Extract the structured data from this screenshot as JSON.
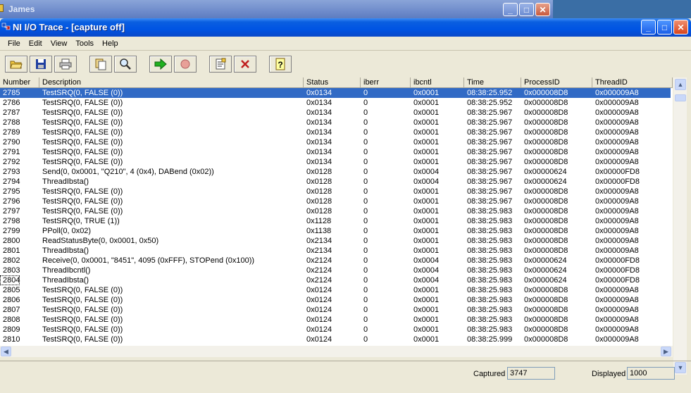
{
  "background_window": {
    "title": "James"
  },
  "window": {
    "title": "NI I/O Trace - [capture off]"
  },
  "menu": [
    "File",
    "Edit",
    "View",
    "Tools",
    "Help"
  ],
  "toolbar": [
    "open-icon",
    "save-icon",
    "print-icon",
    "copy-icon",
    "find-icon",
    "start-capture-icon",
    "stop-capture-icon",
    "properties-icon",
    "delete-icon",
    "help-icon"
  ],
  "columns": [
    "Number",
    "Description",
    "Status",
    "iberr",
    "ibcntl",
    "Time",
    "ProcessID",
    "ThreadID"
  ],
  "rows": [
    [
      "2785",
      "TestSRQ(0, FALSE (0))",
      "0x0134",
      "0",
      "0x0001",
      "08:38:25.952",
      "0x000008D8",
      "0x000009A8"
    ],
    [
      "2786",
      "TestSRQ(0, FALSE (0))",
      "0x0134",
      "0",
      "0x0001",
      "08:38:25.952",
      "0x000008D8",
      "0x000009A8"
    ],
    [
      "2787",
      "TestSRQ(0, FALSE (0))",
      "0x0134",
      "0",
      "0x0001",
      "08:38:25.967",
      "0x000008D8",
      "0x000009A8"
    ],
    [
      "2788",
      "TestSRQ(0, FALSE (0))",
      "0x0134",
      "0",
      "0x0001",
      "08:38:25.967",
      "0x000008D8",
      "0x000009A8"
    ],
    [
      "2789",
      "TestSRQ(0, FALSE (0))",
      "0x0134",
      "0",
      "0x0001",
      "08:38:25.967",
      "0x000008D8",
      "0x000009A8"
    ],
    [
      "2790",
      "TestSRQ(0, FALSE (0))",
      "0x0134",
      "0",
      "0x0001",
      "08:38:25.967",
      "0x000008D8",
      "0x000009A8"
    ],
    [
      "2791",
      "TestSRQ(0, FALSE (0))",
      "0x0134",
      "0",
      "0x0001",
      "08:38:25.967",
      "0x000008D8",
      "0x000009A8"
    ],
    [
      "2792",
      "TestSRQ(0, FALSE (0))",
      "0x0134",
      "0",
      "0x0001",
      "08:38:25.967",
      "0x000008D8",
      "0x000009A8"
    ],
    [
      "2793",
      "Send(0, 0x0001, \"Q210\", 4 (0x4), DABend (0x02))",
      "0x0128",
      "0",
      "0x0004",
      "08:38:25.967",
      "0x00000624",
      "0x00000FD8"
    ],
    [
      "2794",
      "ThreadIbsta()",
      "0x0128",
      "0",
      "0x0004",
      "08:38:25.967",
      "0x00000624",
      "0x00000FD8"
    ],
    [
      "2795",
      "TestSRQ(0, FALSE (0))",
      "0x0128",
      "0",
      "0x0001",
      "08:38:25.967",
      "0x000008D8",
      "0x000009A8"
    ],
    [
      "2796",
      "TestSRQ(0, FALSE (0))",
      "0x0128",
      "0",
      "0x0001",
      "08:38:25.967",
      "0x000008D8",
      "0x000009A8"
    ],
    [
      "2797",
      "TestSRQ(0, FALSE (0))",
      "0x0128",
      "0",
      "0x0001",
      "08:38:25.983",
      "0x000008D8",
      "0x000009A8"
    ],
    [
      "2798",
      "TestSRQ(0, TRUE (1))",
      "0x1128",
      "0",
      "0x0001",
      "08:38:25.983",
      "0x000008D8",
      "0x000009A8"
    ],
    [
      "2799",
      "PPoll(0, 0x02)",
      "0x1138",
      "0",
      "0x0001",
      "08:38:25.983",
      "0x000008D8",
      "0x000009A8"
    ],
    [
      "2800",
      "ReadStatusByte(0, 0x0001, 0x50)",
      "0x2134",
      "0",
      "0x0001",
      "08:38:25.983",
      "0x000008D8",
      "0x000009A8"
    ],
    [
      "2801",
      "ThreadIbsta()",
      "0x2134",
      "0",
      "0x0001",
      "08:38:25.983",
      "0x000008D8",
      "0x000009A8"
    ],
    [
      "2802",
      "Receive(0, 0x0001, \"8451\", 4095 (0xFFF), STOPend (0x100))",
      "0x2124",
      "0",
      "0x0004",
      "08:38:25.983",
      "0x00000624",
      "0x00000FD8"
    ],
    [
      "2803",
      "ThreadIbcntl()",
      "0x2124",
      "0",
      "0x0004",
      "08:38:25.983",
      "0x00000624",
      "0x00000FD8"
    ],
    [
      "2804",
      "ThreadIbsta()",
      "0x2124",
      "0",
      "0x0004",
      "08:38:25.983",
      "0x00000624",
      "0x00000FD8"
    ],
    [
      "2805",
      "TestSRQ(0, FALSE (0))",
      "0x0124",
      "0",
      "0x0001",
      "08:38:25.983",
      "0x000008D8",
      "0x000009A8"
    ],
    [
      "2806",
      "TestSRQ(0, FALSE (0))",
      "0x0124",
      "0",
      "0x0001",
      "08:38:25.983",
      "0x000008D8",
      "0x000009A8"
    ],
    [
      "2807",
      "TestSRQ(0, FALSE (0))",
      "0x0124",
      "0",
      "0x0001",
      "08:38:25.983",
      "0x000008D8",
      "0x000009A8"
    ],
    [
      "2808",
      "TestSRQ(0, FALSE (0))",
      "0x0124",
      "0",
      "0x0001",
      "08:38:25.983",
      "0x000008D8",
      "0x000009A8"
    ],
    [
      "2809",
      "TestSRQ(0, FALSE (0))",
      "0x0124",
      "0",
      "0x0001",
      "08:38:25.983",
      "0x000008D8",
      "0x000009A8"
    ],
    [
      "2810",
      "TestSRQ(0, FALSE (0))",
      "0x0124",
      "0",
      "0x0001",
      "08:38:25.999",
      "0x000008D8",
      "0x000009A8"
    ]
  ],
  "selected_row": "2785",
  "focused_row": "2804",
  "status": {
    "captured_label": "Captured",
    "captured_value": "3747",
    "displayed_label": "Displayed",
    "displayed_value": "1000"
  },
  "colors": {
    "selection": "#316ac5",
    "titlebar": "#0054e3"
  }
}
